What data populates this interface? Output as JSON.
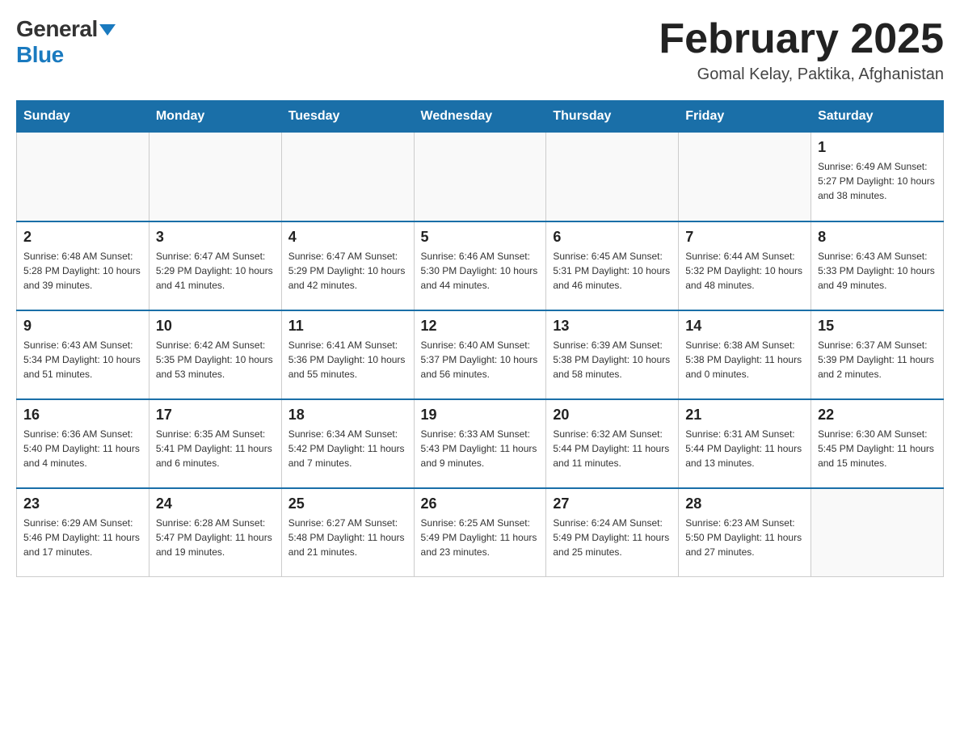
{
  "header": {
    "logo_general": "General",
    "logo_blue": "Blue",
    "month_title": "February 2025",
    "location": "Gomal Kelay, Paktika, Afghanistan"
  },
  "days_of_week": [
    "Sunday",
    "Monday",
    "Tuesday",
    "Wednesday",
    "Thursday",
    "Friday",
    "Saturday"
  ],
  "weeks": [
    [
      {
        "day": "",
        "info": ""
      },
      {
        "day": "",
        "info": ""
      },
      {
        "day": "",
        "info": ""
      },
      {
        "day": "",
        "info": ""
      },
      {
        "day": "",
        "info": ""
      },
      {
        "day": "",
        "info": ""
      },
      {
        "day": "1",
        "info": "Sunrise: 6:49 AM\nSunset: 5:27 PM\nDaylight: 10 hours and 38 minutes."
      }
    ],
    [
      {
        "day": "2",
        "info": "Sunrise: 6:48 AM\nSunset: 5:28 PM\nDaylight: 10 hours and 39 minutes."
      },
      {
        "day": "3",
        "info": "Sunrise: 6:47 AM\nSunset: 5:29 PM\nDaylight: 10 hours and 41 minutes."
      },
      {
        "day": "4",
        "info": "Sunrise: 6:47 AM\nSunset: 5:29 PM\nDaylight: 10 hours and 42 minutes."
      },
      {
        "day": "5",
        "info": "Sunrise: 6:46 AM\nSunset: 5:30 PM\nDaylight: 10 hours and 44 minutes."
      },
      {
        "day": "6",
        "info": "Sunrise: 6:45 AM\nSunset: 5:31 PM\nDaylight: 10 hours and 46 minutes."
      },
      {
        "day": "7",
        "info": "Sunrise: 6:44 AM\nSunset: 5:32 PM\nDaylight: 10 hours and 48 minutes."
      },
      {
        "day": "8",
        "info": "Sunrise: 6:43 AM\nSunset: 5:33 PM\nDaylight: 10 hours and 49 minutes."
      }
    ],
    [
      {
        "day": "9",
        "info": "Sunrise: 6:43 AM\nSunset: 5:34 PM\nDaylight: 10 hours and 51 minutes."
      },
      {
        "day": "10",
        "info": "Sunrise: 6:42 AM\nSunset: 5:35 PM\nDaylight: 10 hours and 53 minutes."
      },
      {
        "day": "11",
        "info": "Sunrise: 6:41 AM\nSunset: 5:36 PM\nDaylight: 10 hours and 55 minutes."
      },
      {
        "day": "12",
        "info": "Sunrise: 6:40 AM\nSunset: 5:37 PM\nDaylight: 10 hours and 56 minutes."
      },
      {
        "day": "13",
        "info": "Sunrise: 6:39 AM\nSunset: 5:38 PM\nDaylight: 10 hours and 58 minutes."
      },
      {
        "day": "14",
        "info": "Sunrise: 6:38 AM\nSunset: 5:38 PM\nDaylight: 11 hours and 0 minutes."
      },
      {
        "day": "15",
        "info": "Sunrise: 6:37 AM\nSunset: 5:39 PM\nDaylight: 11 hours and 2 minutes."
      }
    ],
    [
      {
        "day": "16",
        "info": "Sunrise: 6:36 AM\nSunset: 5:40 PM\nDaylight: 11 hours and 4 minutes."
      },
      {
        "day": "17",
        "info": "Sunrise: 6:35 AM\nSunset: 5:41 PM\nDaylight: 11 hours and 6 minutes."
      },
      {
        "day": "18",
        "info": "Sunrise: 6:34 AM\nSunset: 5:42 PM\nDaylight: 11 hours and 7 minutes."
      },
      {
        "day": "19",
        "info": "Sunrise: 6:33 AM\nSunset: 5:43 PM\nDaylight: 11 hours and 9 minutes."
      },
      {
        "day": "20",
        "info": "Sunrise: 6:32 AM\nSunset: 5:44 PM\nDaylight: 11 hours and 11 minutes."
      },
      {
        "day": "21",
        "info": "Sunrise: 6:31 AM\nSunset: 5:44 PM\nDaylight: 11 hours and 13 minutes."
      },
      {
        "day": "22",
        "info": "Sunrise: 6:30 AM\nSunset: 5:45 PM\nDaylight: 11 hours and 15 minutes."
      }
    ],
    [
      {
        "day": "23",
        "info": "Sunrise: 6:29 AM\nSunset: 5:46 PM\nDaylight: 11 hours and 17 minutes."
      },
      {
        "day": "24",
        "info": "Sunrise: 6:28 AM\nSunset: 5:47 PM\nDaylight: 11 hours and 19 minutes."
      },
      {
        "day": "25",
        "info": "Sunrise: 6:27 AM\nSunset: 5:48 PM\nDaylight: 11 hours and 21 minutes."
      },
      {
        "day": "26",
        "info": "Sunrise: 6:25 AM\nSunset: 5:49 PM\nDaylight: 11 hours and 23 minutes."
      },
      {
        "day": "27",
        "info": "Sunrise: 6:24 AM\nSunset: 5:49 PM\nDaylight: 11 hours and 25 minutes."
      },
      {
        "day": "28",
        "info": "Sunrise: 6:23 AM\nSunset: 5:50 PM\nDaylight: 11 hours and 27 minutes."
      },
      {
        "day": "",
        "info": ""
      }
    ]
  ]
}
